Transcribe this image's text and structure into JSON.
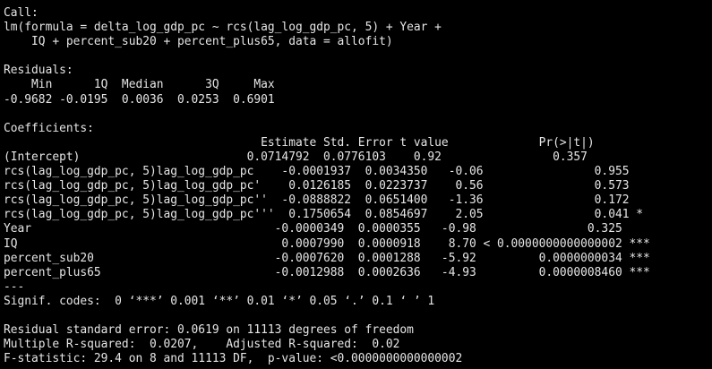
{
  "console": {
    "lines": [
      "Call:",
      "lm(formula = delta_log_gdp_pc ~ rcs(lag_log_gdp_pc, 5) + Year +",
      "    IQ + percent_sub20 + percent_plus65, data = allofit)",
      "",
      "Residuals:",
      "    Min      1Q  Median      3Q     Max ",
      "-0.9682 -0.0195  0.0036  0.0253  0.6901 ",
      "",
      "Coefficients:",
      "                                     Estimate Std. Error t value             Pr(>|t|)    ",
      "(Intercept)                        0.0714792  0.0776103    0.92                0.357    ",
      "rcs(lag_log_gdp_pc, 5)lag_log_gdp_pc    -0.0001937  0.0034350   -0.06                0.955    ",
      "rcs(lag_log_gdp_pc, 5)lag_log_gdp_pc'    0.0126185  0.0223737    0.56                0.573    ",
      "rcs(lag_log_gdp_pc, 5)lag_log_gdp_pc''  -0.0888822  0.0651400   -1.36                0.172    ",
      "rcs(lag_log_gdp_pc, 5)lag_log_gdp_pc'''  0.1750654  0.0854697    2.05                0.041 *  ",
      "Year                                   -0.0000349  0.0000355   -0.98                0.325    ",
      "IQ                                      0.0007990  0.0000918    8.70 < 0.0000000000000002 ***",
      "percent_sub20                          -0.0007620  0.0001288   -5.92         0.0000000034 ***",
      "percent_plus65                         -0.0012988  0.0002636   -4.93         0.0000008460 ***",
      "---",
      "Signif. codes:  0 ‘***’ 0.001 ‘**’ 0.01 ‘*’ 0.05 ‘.’ 0.1 ‘ ’ 1",
      "",
      "Residual standard error: 0.0619 on 11113 degrees of freedom",
      "Multiple R-squared:  0.0207,\tAdjusted R-squared:  0.02 ",
      "F-statistic: 29.4 on 8 and 11113 DF,  p-value: <0.0000000000000002"
    ]
  },
  "colors": {
    "background": "#000000",
    "text": "#e6e6e6"
  }
}
